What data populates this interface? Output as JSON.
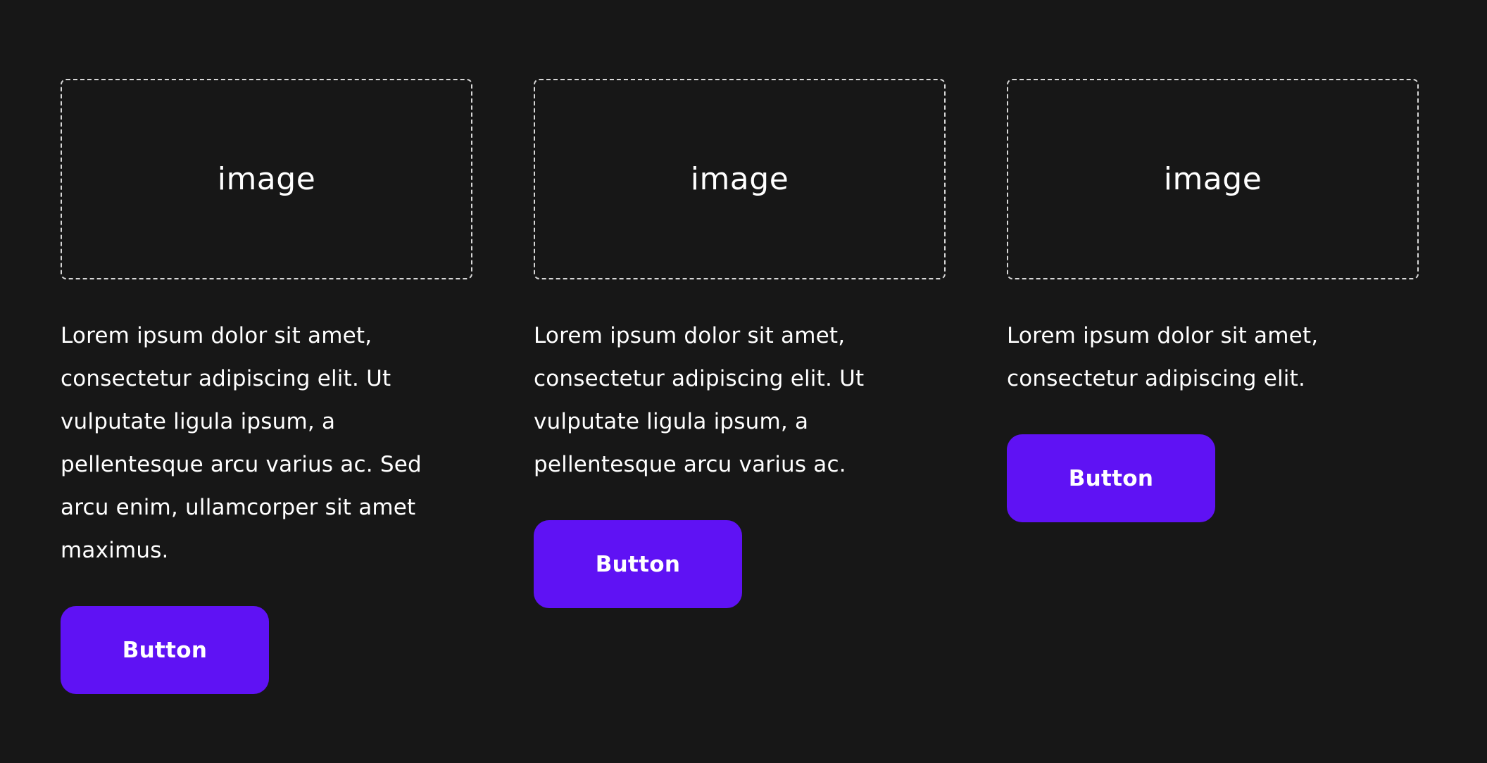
{
  "colors": {
    "background": "#171717",
    "button": "#5f12f4",
    "text": "#ffffff",
    "placeholder_border": "#d8d8d8"
  },
  "cards": [
    {
      "image_label": "image",
      "text": "Lorem ipsum dolor sit amet, consectetur adipiscing elit. Ut vulputate ligula ipsum, a pellentesque arcu varius ac. Sed arcu enim, ullamcorper sit amet maximus.",
      "button_label": "Button"
    },
    {
      "image_label": "image",
      "text": "Lorem ipsum dolor sit amet, consectetur adipiscing elit. Ut vulputate ligula ipsum, a pellentesque arcu varius ac.",
      "button_label": "Button"
    },
    {
      "image_label": "image",
      "text": "Lorem ipsum dolor sit amet, consectetur adipiscing elit.",
      "button_label": "Button"
    }
  ]
}
